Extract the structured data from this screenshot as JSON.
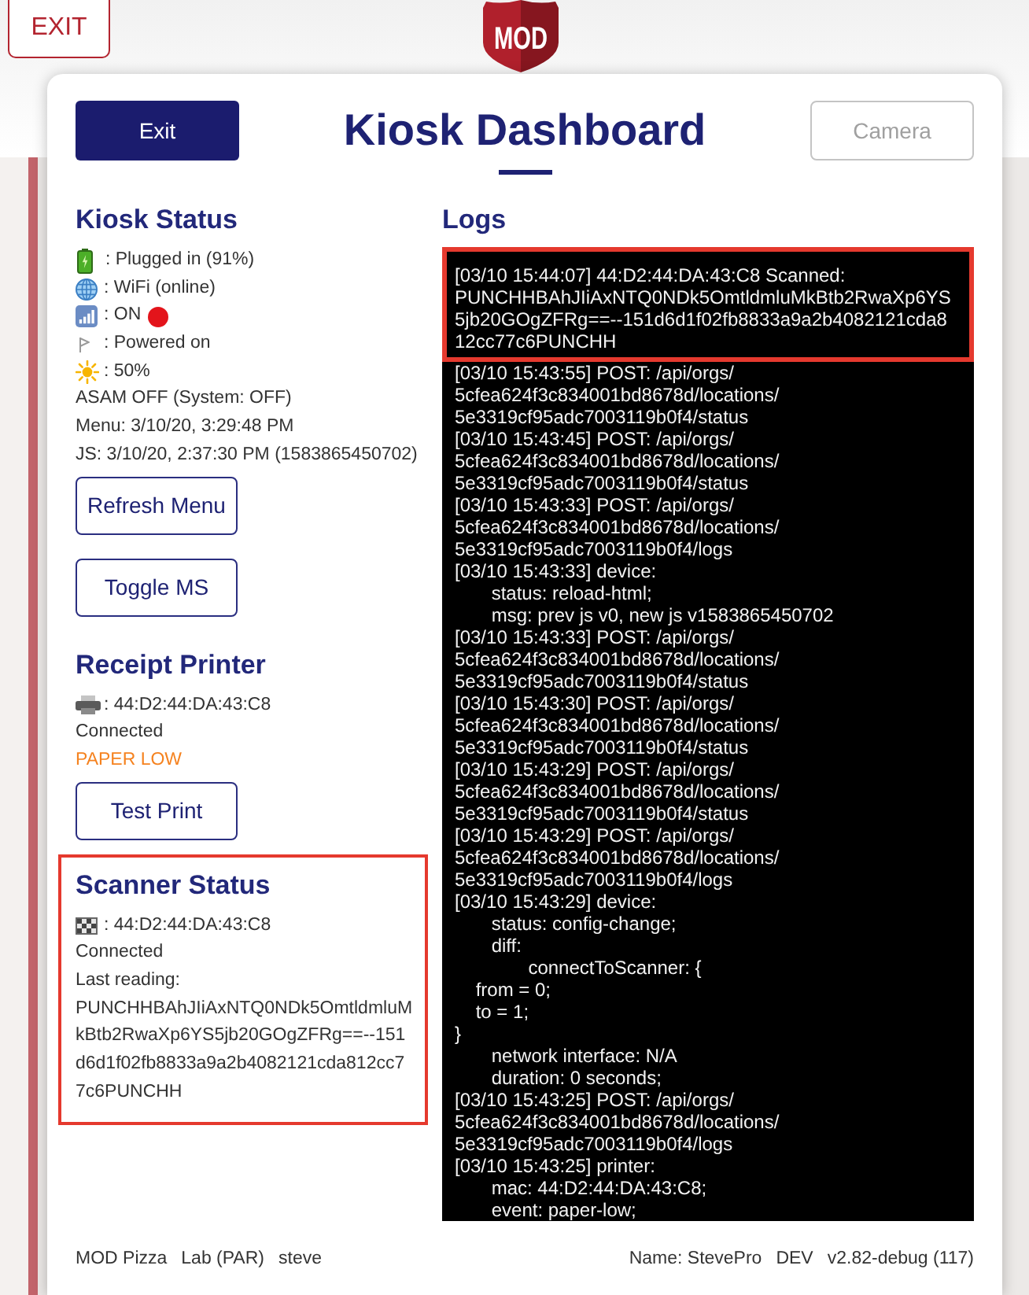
{
  "backdrop": {
    "exit_button": "EXIT",
    "logo_text": "MOD"
  },
  "dashboard": {
    "title": "Kiosk Dashboard",
    "exit_button": "Exit",
    "camera_button": {
      "label": "Camera",
      "disabled": true
    }
  },
  "kiosk_status": {
    "title": "Kiosk Status",
    "items": [
      {
        "kind": "battery",
        "text": ": Plugged in (91%)"
      },
      {
        "kind": "network",
        "text": ": WiFi (online)"
      },
      {
        "kind": "cellular",
        "text": ": ON",
        "color": "#e3141b"
      },
      {
        "kind": "power",
        "text": ": Powered on"
      },
      {
        "kind": "brightness",
        "text": ": 50%"
      },
      {
        "kind": "plain",
        "text": "ASAM OFF (System: OFF)"
      },
      {
        "kind": "plain",
        "text": "Menu: 3/10/20, 3:29:48 PM"
      },
      {
        "kind": "plain",
        "text": "JS: 3/10/20, 2:37:30 PM (1583865450702)"
      }
    ],
    "buttons": [
      "Refresh Menu",
      "Toggle MS"
    ]
  },
  "receipt_printer": {
    "title": "Receipt Printer",
    "device": ": 44:D2:44:DA:43:C8",
    "connection": "Connected",
    "alert": "PAPER LOW",
    "button": "Test Print"
  },
  "scanner_status": {
    "title": "Scanner Status",
    "highlighted": true,
    "device": ": 44:D2:44:DA:43:C8",
    "connection": "Connected",
    "reading_label": "Last reading:",
    "reading": "PUNCHHBAhJIiAxNTQ0NDk5OmtldmluMkBtb2RwaXp6YS5jb20GOgZFRg==--151d6d1f02fb8833a9a2b4082121cda812cc77c6PUNCHH"
  },
  "logs": {
    "title": "Logs",
    "entries": [
      {
        "highlighted": true,
        "lines": [
          "[03/10 15:44:07] 44:D2:44:DA:43:C8 Scanned:",
          "PUNCHHBAhJIiAxNTQ0NDk5OmtldmluMkBtb2RwaXp6YS",
          "5jb20GOgZFRg==--151d6d1f02fb8833a9a2b4082121cda8",
          "12cc77c6PUNCHH"
        ]
      },
      {
        "highlighted": false,
        "lines": [
          "[03/10 15:43:55] POST: /api/orgs/",
          "5cfea624f3c834001bd8678d/locations/",
          "5e3319cf95adc7003119b0f4/status"
        ]
      },
      {
        "highlighted": false,
        "lines": [
          "[03/10 15:43:45] POST: /api/orgs/",
          "5cfea624f3c834001bd8678d/locations/",
          "5e3319cf95adc7003119b0f4/status"
        ]
      },
      {
        "highlighted": false,
        "lines": [
          "[03/10 15:43:33] POST: /api/orgs/",
          "5cfea624f3c834001bd8678d/locations/",
          "5e3319cf95adc7003119b0f4/logs"
        ]
      },
      {
        "highlighted": false,
        "lines": [
          "[03/10 15:43:33] device:",
          "\tstatus: reload-html;",
          "\tmsg: prev js v0, new js v1583865450702"
        ]
      },
      {
        "highlighted": false,
        "lines": [
          "[03/10 15:43:33] POST: /api/orgs/",
          "5cfea624f3c834001bd8678d/locations/",
          "5e3319cf95adc7003119b0f4/status"
        ]
      },
      {
        "highlighted": false,
        "lines": [
          "[03/10 15:43:30] POST: /api/orgs/",
          "5cfea624f3c834001bd8678d/locations/",
          "5e3319cf95adc7003119b0f4/status"
        ]
      },
      {
        "highlighted": false,
        "lines": [
          "[03/10 15:43:29] POST: /api/orgs/",
          "5cfea624f3c834001bd8678d/locations/",
          "5e3319cf95adc7003119b0f4/status"
        ]
      },
      {
        "highlighted": false,
        "lines": [
          "[03/10 15:43:29] POST: /api/orgs/",
          "5cfea624f3c834001bd8678d/locations/",
          "5e3319cf95adc7003119b0f4/logs"
        ]
      },
      {
        "highlighted": false,
        "lines": [
          "[03/10 15:43:29] device:",
          "\tstatus: config-change;",
          "\tdiff:",
          "\t\tconnectToScanner: {",
          "    from = 0;",
          "    to = 1;",
          "}",
          "\tnetwork interface: N/A",
          "\tduration: 0 seconds;"
        ]
      },
      {
        "highlighted": false,
        "lines": [
          "[03/10 15:43:25] POST: /api/orgs/",
          "5cfea624f3c834001bd8678d/locations/",
          "5e3319cf95adc7003119b0f4/logs"
        ]
      },
      {
        "highlighted": false,
        "lines": [
          "[03/10 15:43:25] printer:",
          "\tmac: 44:D2:44:DA:43:C8;",
          "\tevent: paper-low;"
        ]
      }
    ]
  },
  "footer": {
    "left": [
      "MOD Pizza",
      "Lab (PAR)",
      "steve"
    ],
    "right": [
      "Name: StevePro",
      "DEV",
      "v2.82-debug (117)"
    ]
  }
}
